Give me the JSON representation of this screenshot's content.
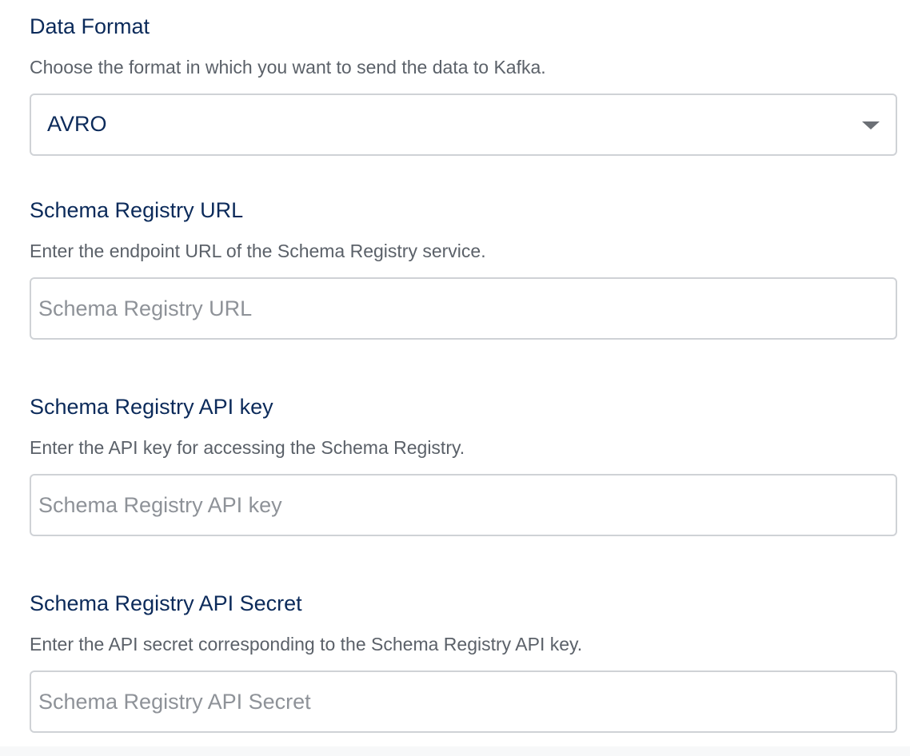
{
  "data_format": {
    "label": "Data Format",
    "description": "Choose the format in which you want to send the data to Kafka.",
    "selected_value": "AVRO",
    "icon": "chevron-down-icon"
  },
  "schema_registry_url": {
    "label": "Schema Registry URL",
    "description": "Enter the endpoint URL of the Schema Registry service.",
    "value": "",
    "placeholder": "Schema Registry URL"
  },
  "schema_registry_api_key": {
    "label": "Schema Registry API key",
    "description": "Enter the API key for accessing the Schema Registry.",
    "value": "",
    "placeholder": "Schema Registry API key"
  },
  "schema_registry_api_secret": {
    "label": "Schema Registry API Secret",
    "description": "Enter the API secret corresponding to the Schema Registry API key.",
    "value": "",
    "placeholder": "Schema Registry API Secret"
  },
  "colors": {
    "label": "#0b2a5a",
    "description": "#5b6169",
    "border": "#cfd2d6",
    "placeholder": "#8e9298"
  }
}
